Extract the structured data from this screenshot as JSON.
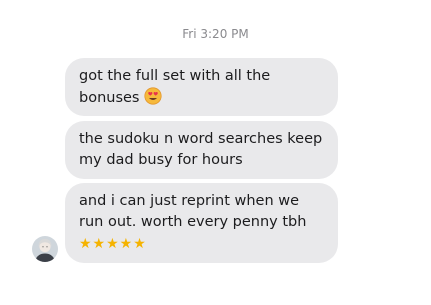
{
  "timestamp": "Fri 3:20 PM",
  "messages": [
    {
      "text": "got the full set with all the bonuses",
      "emoji": "heart-eyes-emoji"
    },
    {
      "text": "the sudoku n word searches keep my dad busy for hours"
    },
    {
      "text": "and i can just reprint when we run out. worth every penny tbh",
      "stars": "★★★★★",
      "rating": 5
    }
  ],
  "colors": {
    "bubble": "#e9e9eb",
    "text": "#1c1c1e",
    "timestamp": "#8a8a8e",
    "stars": "#f5b301"
  },
  "avatar": {
    "icon": "person-avatar"
  }
}
